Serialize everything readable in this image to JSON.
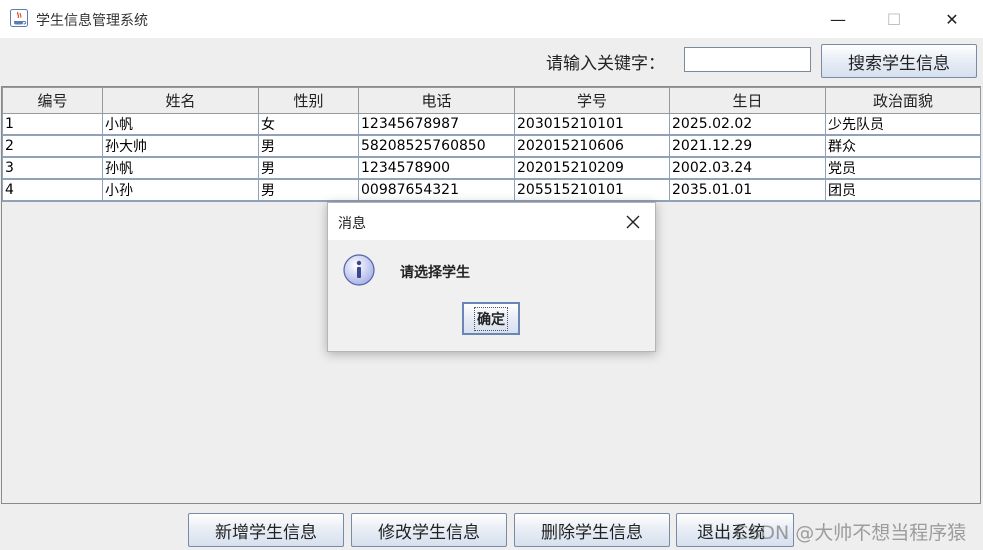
{
  "window": {
    "title": "学生信息管理系统",
    "minimize_glyph": "—",
    "maximize_glyph": "☐",
    "close_glyph": "✕"
  },
  "search": {
    "label": "请输入关键字：",
    "value": "",
    "button_label": "搜索学生信息"
  },
  "table": {
    "columns": [
      "编号",
      "姓名",
      "性别",
      "电话",
      "学号",
      "生日",
      "政治面貌"
    ],
    "rows": [
      [
        "1",
        "小帆",
        "女",
        "12345678987",
        "203015210101",
        "2025.02.02",
        "少先队员"
      ],
      [
        "2",
        "孙大帅",
        "男",
        "58208525760850",
        "202015210606",
        "2021.12.29",
        "群众"
      ],
      [
        "3",
        "孙帆",
        "男",
        "1234578900",
        "202015210209",
        "2002.03.24",
        "党员"
      ],
      [
        "4",
        "小孙",
        "男",
        "00987654321",
        "205515210101",
        "2035.01.01",
        "团员"
      ]
    ]
  },
  "actions": {
    "add": "新增学生信息",
    "edit": "修改学生信息",
    "delete": "删除学生信息",
    "exit": "退出系统"
  },
  "dialog": {
    "title": "消息",
    "message": "请选择学生",
    "ok_label": "确定",
    "icon": "info-icon"
  },
  "watermark": "CSDN @大帅不想当程序猿"
}
